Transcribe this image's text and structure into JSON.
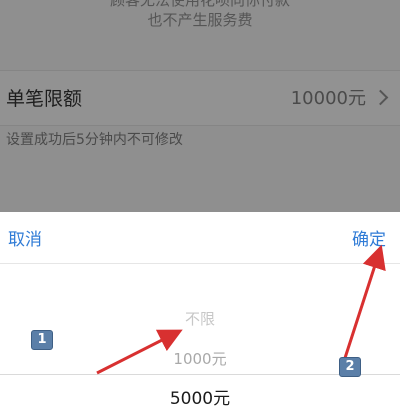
{
  "background_page": {
    "notice_line1": "顾客无法使用花呗向你付款",
    "notice_line2": "也不产生服务费",
    "limit_row": {
      "label": "单笔限额",
      "value": "10000元",
      "chevron_icon": "chevron-right-icon"
    },
    "hint": "设置成功后5分钟内不可修改"
  },
  "picker": {
    "cancel_label": "取消",
    "confirm_label": "确定",
    "options": [
      "不限",
      "1000元",
      "5000元"
    ],
    "selected_value": "5000元",
    "accent_color": "#2f7bd6"
  },
  "annotations": {
    "badge_1": "1",
    "badge_2": "2",
    "arrow_color": "#d83030"
  }
}
